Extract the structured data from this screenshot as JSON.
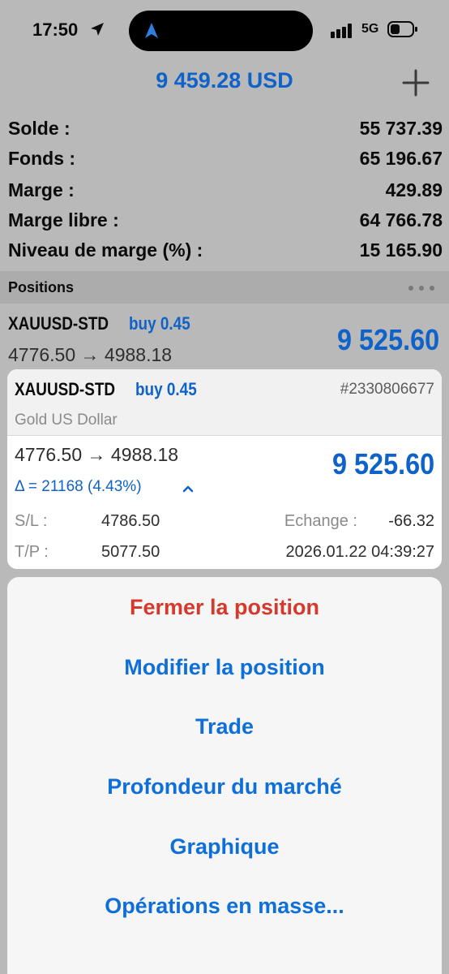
{
  "status_bar": {
    "time": "17:50",
    "network": "5G"
  },
  "header": {
    "equity": "9 459.28 USD"
  },
  "account": {
    "rows": [
      {
        "label": "Solde :",
        "value": "55 737.39"
      },
      {
        "label": "Fonds :",
        "value": "65 196.67"
      },
      {
        "label": "Marge :",
        "value": "429.89"
      },
      {
        "label": "Marge libre :",
        "value": "64 766.78"
      },
      {
        "label": "Niveau de marge (%) :",
        "value": "15 165.90"
      }
    ]
  },
  "positions_section": {
    "title": "Positions"
  },
  "position": {
    "symbol": "XAUUSD-STD",
    "side": "buy 0.45",
    "prices": "4776.50 → 4988.18",
    "profit": "9 525.60"
  },
  "detail": {
    "symbol": "XAUUSD-STD",
    "side": "buy 0.45",
    "ticket": "#2330806677",
    "description": "Gold US Dollar",
    "prices": "4776.50 → 4988.18",
    "profit": "9 525.60",
    "delta": "Δ = 21168 (4.43%)",
    "sl_label": "S/L :",
    "sl_value": "4786.50",
    "tp_label": "T/P :",
    "tp_value": "5077.50",
    "swap_label": "Echange :",
    "swap_value": "-66.32",
    "open_time": "2026.01.22 04:39:27"
  },
  "actions": {
    "close": "Fermer la position",
    "modify": "Modifier la position",
    "trade": "Trade",
    "depth": "Profondeur du marché",
    "chart": "Graphique",
    "bulk": "Opérations en masse..."
  },
  "colors": {
    "accent": "#0f62c8",
    "action_blue": "#0f6fd9",
    "destructive": "#d6392c",
    "dim_background": "#b9b9b9"
  },
  "icons": [
    "location-arrow-icon",
    "signal-bars-icon",
    "battery-icon",
    "plus-icon",
    "more-dots-icon",
    "chevron-up-icon"
  ]
}
